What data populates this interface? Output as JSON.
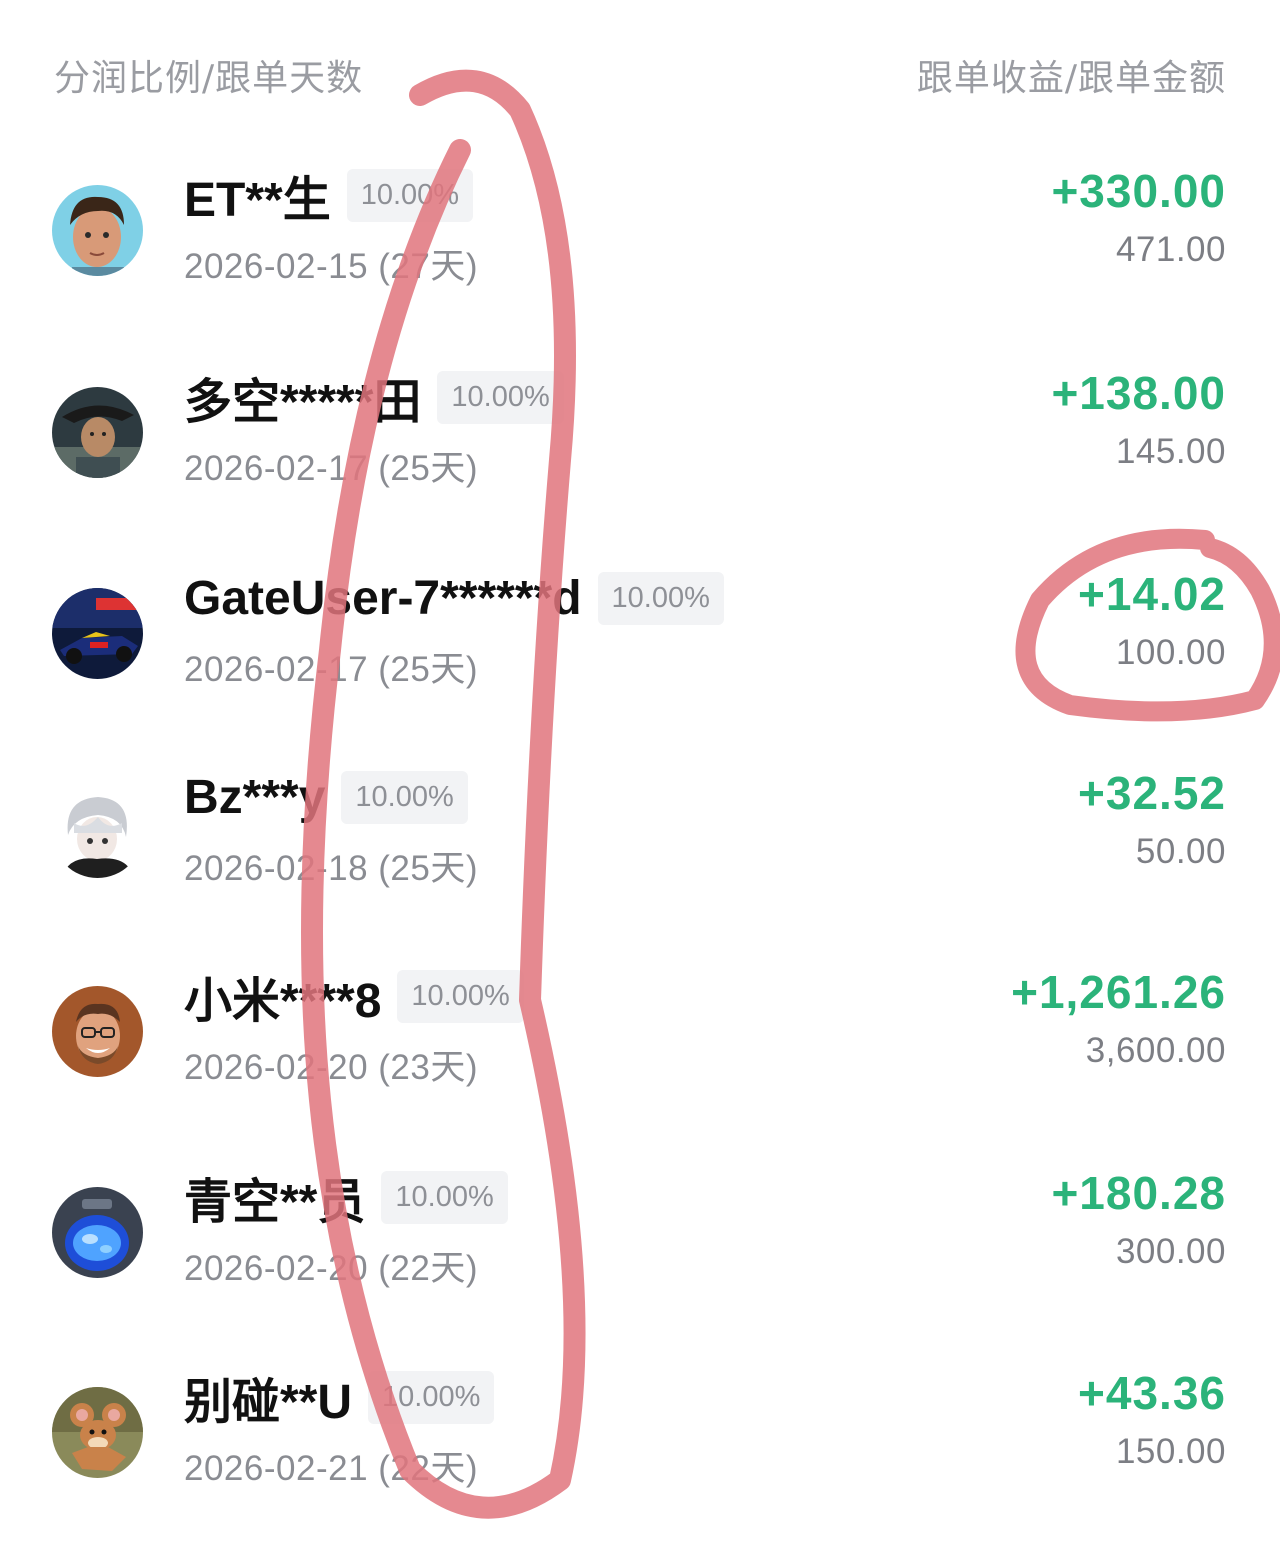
{
  "header": {
    "left_label": "分润比例/跟单天数",
    "right_label": "跟单收益/跟单金额"
  },
  "colors": {
    "profit": "#2bb37a",
    "muted_text": "#8a8c92",
    "badge_bg": "#f2f3f5",
    "scribble": "#e0747c"
  },
  "rows": [
    {
      "name": "ET**生",
      "ratio": "10.00%",
      "date": "2026-02-15 (27天)",
      "profit": "+330.00",
      "amount": "471.00",
      "avatar_icon": "young-man-avatar-icon"
    },
    {
      "name": "多空*****田",
      "ratio": "10.00%",
      "date": "2026-02-17 (25天)",
      "profit": "+138.00",
      "amount": "145.00",
      "avatar_icon": "old-man-hat-avatar-icon"
    },
    {
      "name": "GateUser-7******d",
      "ratio": "10.00%",
      "date": "2026-02-17 (25天)",
      "profit": "+14.02",
      "amount": "100.00",
      "avatar_icon": "race-car-avatar-icon"
    },
    {
      "name": "Bz***y",
      "ratio": "10.00%",
      "date": "2026-02-18 (25天)",
      "profit": "+32.52",
      "amount": "50.00",
      "avatar_icon": "anime-character-avatar-icon"
    },
    {
      "name": "小米****8",
      "ratio": "10.00%",
      "date": "2026-02-20 (23天)",
      "profit": "+1,261.26",
      "amount": "3,600.00",
      "avatar_icon": "smiling-man-glasses-avatar-icon"
    },
    {
      "name": "青空**员",
      "ratio": "10.00%",
      "date": "2026-02-20 (22天)",
      "profit": "+180.28",
      "amount": "300.00",
      "avatar_icon": "glowing-jar-avatar-icon"
    },
    {
      "name": "别碰**U",
      "ratio": "10.00%",
      "date": "2026-02-21 (22天)",
      "profit": "+43.36",
      "amount": "150.00",
      "avatar_icon": "cartoon-mouse-avatar-icon"
    }
  ]
}
